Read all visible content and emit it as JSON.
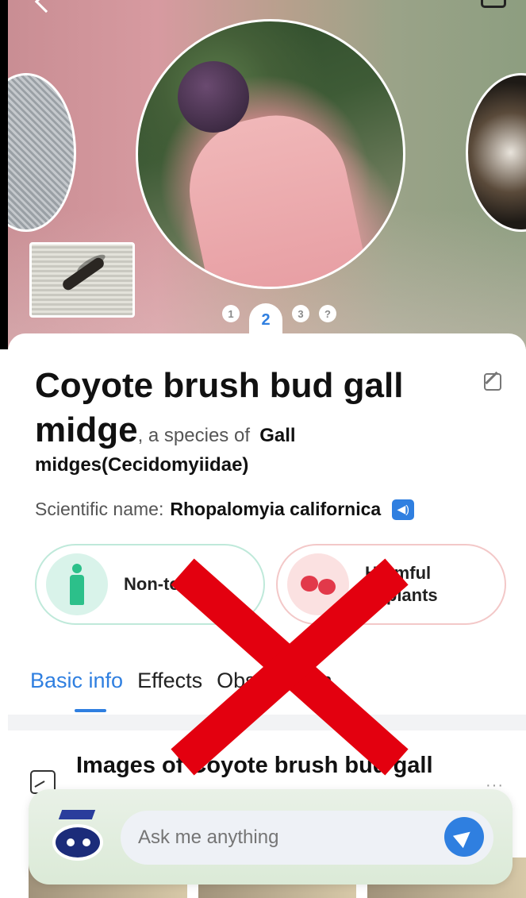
{
  "header": {
    "back_icon": "back-arrow-icon",
    "top_right_icon": "camera-icon"
  },
  "pager": {
    "pages": [
      "1",
      "2",
      "3",
      "?"
    ],
    "active_index": 1
  },
  "species": {
    "title_line1": "Coyote brush bud gall",
    "title_line2": "midge",
    "subtitle": ", a species of",
    "genus_part1": "Gall",
    "genus_part2": "midges(Cecidomyiidae)",
    "scientific_label": "Scientific name:",
    "scientific_name": "Rhopalomyia californica"
  },
  "badges": [
    {
      "text": "Non-toxic",
      "icon": "person-icon",
      "color": "#2cc08a"
    },
    {
      "text_line1": "Harmful",
      "text_line2": "to plants",
      "icon": "berries-icon",
      "color": "#e2394a"
    }
  ],
  "tabs": [
    {
      "label": "Basic info",
      "active": true
    },
    {
      "label": "Effects",
      "active": false
    },
    {
      "label": "Observation",
      "active": false
    }
  ],
  "section": {
    "title": "Images of Coyote brush bud gall",
    "more": "···"
  },
  "ask": {
    "placeholder": "Ask me anything"
  },
  "colors": {
    "accent": "#2f7fe0",
    "overlay_x": "#e3000f"
  }
}
